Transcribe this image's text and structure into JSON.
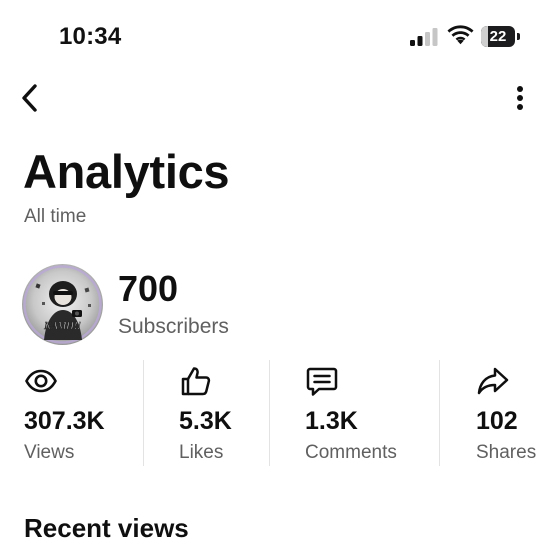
{
  "status_bar": {
    "time": "10:34",
    "battery_level": "22",
    "battery_fraction": 0.22
  },
  "nav": {
    "back_icon": "chevron-left-icon",
    "more_icon": "more-vertical-icon"
  },
  "header": {
    "title": "Analytics",
    "subtitle": "All time"
  },
  "channel": {
    "avatar_text": "NAMH!!",
    "subscriber_count": "700",
    "subscriber_label": "Subscribers"
  },
  "stats": [
    {
      "icon": "eye-icon",
      "value": "307.3K",
      "label": "Views"
    },
    {
      "icon": "thumbs-up-icon",
      "value": "5.3K",
      "label": "Likes"
    },
    {
      "icon": "comment-icon",
      "value": "1.3K",
      "label": "Comments"
    },
    {
      "icon": "share-icon",
      "value": "102",
      "label": "Shares"
    }
  ],
  "sections": {
    "recent_views": "Recent views"
  },
  "colors": {
    "primary_text": "#0f0f0f",
    "secondary_text": "#606060",
    "divider": "#e3e3e3"
  }
}
